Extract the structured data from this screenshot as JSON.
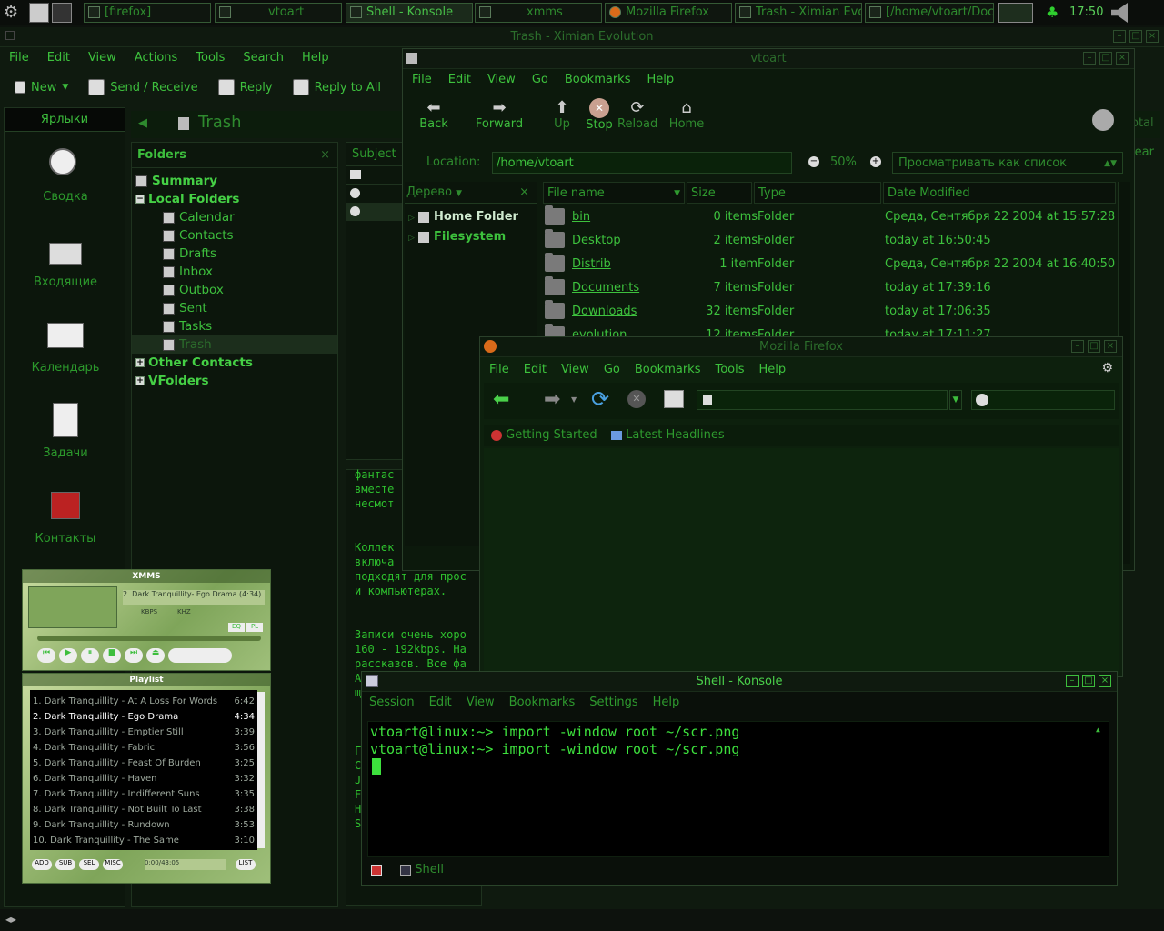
{
  "taskbar": {
    "buttons": [
      {
        "label": "[firefox]"
      },
      {
        "label": "vtoart"
      },
      {
        "label": "Shell - Konsole"
      },
      {
        "label": "xmms"
      },
      {
        "label": "Mozilla Firefox"
      },
      {
        "label": "Trash - Ximian Evo"
      },
      {
        "label": "[/home/vtoart/Doc"
      }
    ],
    "clock": "17:50"
  },
  "evolution": {
    "title": "Trash - Ximian Evolution",
    "menu": [
      "File",
      "Edit",
      "View",
      "Actions",
      "Tools",
      "Search",
      "Help"
    ],
    "toolbar": {
      "new": "New",
      "send_receive": "Send / Receive",
      "reply": "Reply",
      "reply_all": "Reply to All"
    },
    "shortcuts_title": "Ярлыки",
    "shortcuts": [
      "Сводка",
      "Входящие",
      "Календарь",
      "Задачи",
      "Контакты"
    ],
    "folder_title": "Trash",
    "folders_header": "Folders",
    "subject_header": "Subject",
    "tree": {
      "summary": "Summary",
      "local": "Local Folders",
      "children": [
        "Calendar",
        "Contacts",
        "Drafts",
        "Inbox",
        "Outbox",
        "Sent",
        "Tasks",
        "Trash"
      ],
      "other": "Other Contacts",
      "vfolders": "VFolders"
    },
    "partial_right": {
      "total": "otal",
      "clear": "lear"
    },
    "message_lines_a": [
      "фантас",
      "вместе",
      "несмот"
    ],
    "message_lines_b": [
      "Коллек",
      "включа",
      "подходят для прос",
      "и компьютерах."
    ],
    "message_lines_c": [
      "Записи очень хоро",
      "160 - 192kbps. На",
      "рассказов. Все фа",
      "А",
      "щ"
    ],
    "message_lines_d": [
      "Г",
      "С",
      "J",
      "F",
      "Н",
      "S"
    ]
  },
  "nautilus": {
    "title": "vtoart",
    "menu": [
      "File",
      "Edit",
      "View",
      "Go",
      "Bookmarks",
      "Help"
    ],
    "toolbar": {
      "back": "Back",
      "forward": "Forward",
      "up": "Up",
      "stop": "Stop",
      "reload": "Reload",
      "home": "Home"
    },
    "location_label": "Location:",
    "location": "/home/vtoart",
    "zoom": "50%",
    "view_as": "Просматривать как список",
    "side_label": "Дерево",
    "side_items": [
      "Home Folder",
      "Filesystem"
    ],
    "columns": [
      "File name",
      "Size",
      "Type",
      "Date Modified"
    ],
    "files": [
      {
        "name": "bin",
        "size": "0 items",
        "type": "Folder",
        "date": "Среда, Сентября 22 2004 at 15:57:28"
      },
      {
        "name": "Desktop",
        "size": "2 items",
        "type": "Folder",
        "date": "today at 16:50:45"
      },
      {
        "name": "Distrib",
        "size": "1 item",
        "type": "Folder",
        "date": "Среда, Сентября 22 2004 at 16:40:50"
      },
      {
        "name": "Documents",
        "size": "7 items",
        "type": "Folder",
        "date": "today at 17:39:16"
      },
      {
        "name": "Downloads",
        "size": "32 items",
        "type": "Folder",
        "date": "today at 17:06:35"
      },
      {
        "name": "evolution",
        "size": "12 items",
        "type": "Folder",
        "date": "today at 17:11:27"
      }
    ]
  },
  "firefox": {
    "title": "Mozilla Firefox",
    "menu": [
      "File",
      "Edit",
      "View",
      "Go",
      "Bookmarks",
      "Tools",
      "Help"
    ],
    "bookmarks": [
      "Getting Started",
      "Latest Headlines"
    ]
  },
  "konsole": {
    "title": "Shell - Konsole",
    "menu": [
      "Session",
      "Edit",
      "View",
      "Bookmarks",
      "Settings",
      "Help"
    ],
    "lines": [
      "vtoart@linux:~> import -window root ~/scr.png",
      "vtoart@linux:~> import -window root ~/scr.png"
    ],
    "tab": "Shell"
  },
  "xmms": {
    "title": "XMMS",
    "song": "2. Dark Tranquillity- Ego Drama (4:34)",
    "kbps": "KBPS",
    "khz": "KHZ",
    "eq": "EQ",
    "pl": "PL"
  },
  "playlist": {
    "title": "Playlist",
    "items": [
      {
        "n": "1. Dark Tranquillity - At A Loss For Words",
        "t": "6:42"
      },
      {
        "n": "2. Dark Tranquillity - Ego Drama",
        "t": "4:34"
      },
      {
        "n": "3. Dark Tranquillity - Emptier Still",
        "t": "3:39"
      },
      {
        "n": "4. Dark Tranquillity - Fabric",
        "t": "3:56"
      },
      {
        "n": "5. Dark Tranquillity - Feast Of Burden",
        "t": "3:25"
      },
      {
        "n": "6. Dark Tranquillity - Haven",
        "t": "3:32"
      },
      {
        "n": "7. Dark Tranquillity - Indifferent Suns",
        "t": "3:35"
      },
      {
        "n": "8. Dark Tranquillity - Not Built To Last",
        "t": "3:38"
      },
      {
        "n": "9. Dark Tranquillity - Rundown",
        "t": "3:53"
      },
      {
        "n": "10. Dark Tranquillity - The Same",
        "t": "3:10"
      }
    ],
    "buttons": [
      "ADD",
      "SUB",
      "SEL",
      "MISC",
      "LIST"
    ],
    "time": "0:00/43:05"
  },
  "colors": {
    "accent": "#3dbe3d",
    "bg": "#0d120d"
  }
}
